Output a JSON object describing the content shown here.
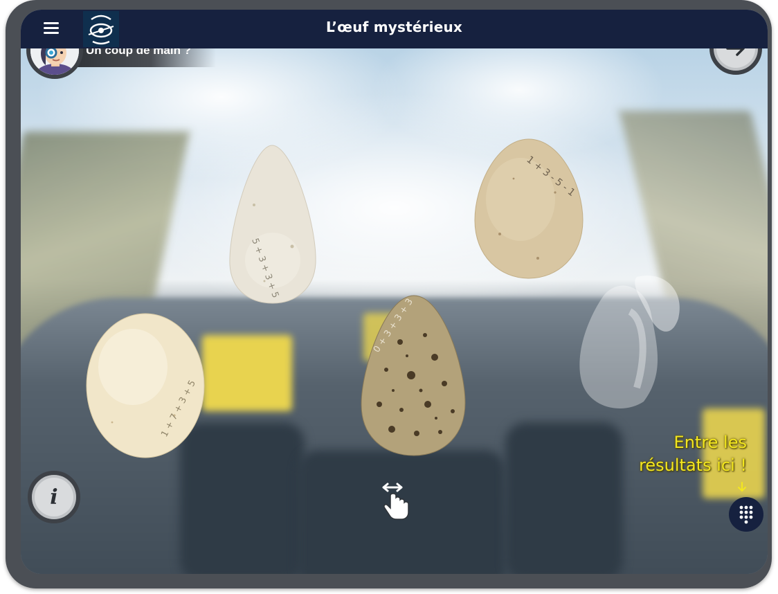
{
  "header": {
    "title": "L’œuf mystérieux",
    "menu_icon": "hamburger-menu-icon",
    "logo_icon": "eye-logo-icon",
    "background_color": "#16213f"
  },
  "helper": {
    "label": "Un coup de main ?",
    "avatar_icon": "detective-avatar-icon"
  },
  "navigation": {
    "next_icon": "arrow-right-icon",
    "info_icon": "info-icon",
    "info_glyph": "i",
    "keypad_icon": "keypad-icon"
  },
  "eggs": [
    {
      "name": "white-pointed-egg",
      "inscription": "5 + 3 + 3 + 5",
      "color": "#e9e4d8"
    },
    {
      "name": "tan-egg",
      "inscription": "1 + 3 - 5 - 1",
      "color": "#d8c6a2"
    },
    {
      "name": "cream-egg",
      "inscription": "1 + 7 + 3 + 5",
      "color": "#f1e6c9"
    },
    {
      "name": "speckled-egg",
      "inscription": "0 + 3 + 3 + 3",
      "color": "#b3a27a"
    }
  ],
  "drop_zone": {
    "name": "egg-slot-placeholder"
  },
  "hint": {
    "line1": "Entre les",
    "line2": "résultats ici !",
    "arrow_icon": "arrow-down-icon",
    "color": "#f3e71f"
  },
  "swipe_icon": "swipe-hand-icon"
}
